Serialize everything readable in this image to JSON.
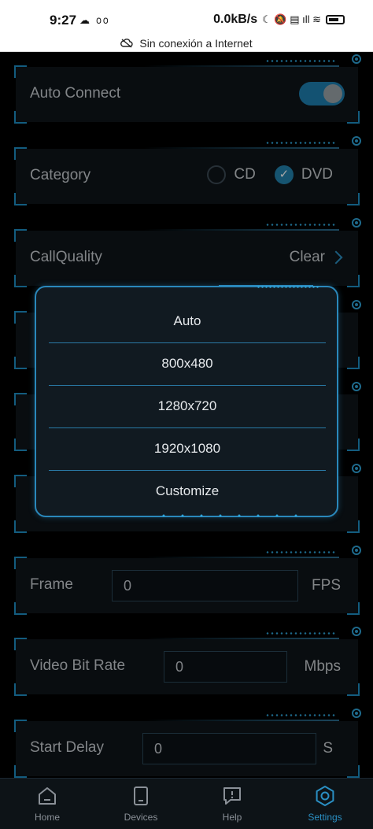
{
  "status": {
    "time": "9:27",
    "left_icons": "☁ ൦൦",
    "speed": "0.0kB/s",
    "right_icons": "☾ 🔕 ▤ ıll ≋"
  },
  "network_banner": "Sin conexión a Internet",
  "settings": {
    "auto_connect": {
      "label": "Auto Connect",
      "enabled": true
    },
    "category": {
      "label": "Category",
      "options": [
        "CD",
        "DVD"
      ],
      "selected": "DVD"
    },
    "call_quality": {
      "label": "CallQuality",
      "value": "Clear"
    },
    "frame": {
      "label": "Frame",
      "value": "0",
      "unit": "FPS"
    },
    "video_bit_rate": {
      "label": "Video Bit Rate",
      "value": "0",
      "unit": "Mbps"
    },
    "start_delay": {
      "label": "Start Delay",
      "value": "0",
      "unit": "S"
    }
  },
  "resolution_dialog": {
    "options": [
      "Auto",
      "800x480",
      "1280x720",
      "1920x1080",
      "Customize"
    ]
  },
  "bottom_nav": {
    "items": [
      {
        "label": "Home",
        "icon": "home-icon"
      },
      {
        "label": "Devices",
        "icon": "tablet-icon"
      },
      {
        "label": "Help",
        "icon": "help-chat-icon"
      },
      {
        "label": "Settings",
        "icon": "settings-hex-icon"
      }
    ],
    "active": "Settings"
  },
  "colors": {
    "accent": "#2a8fc3",
    "background": "#000000",
    "card": "#0e1419"
  }
}
